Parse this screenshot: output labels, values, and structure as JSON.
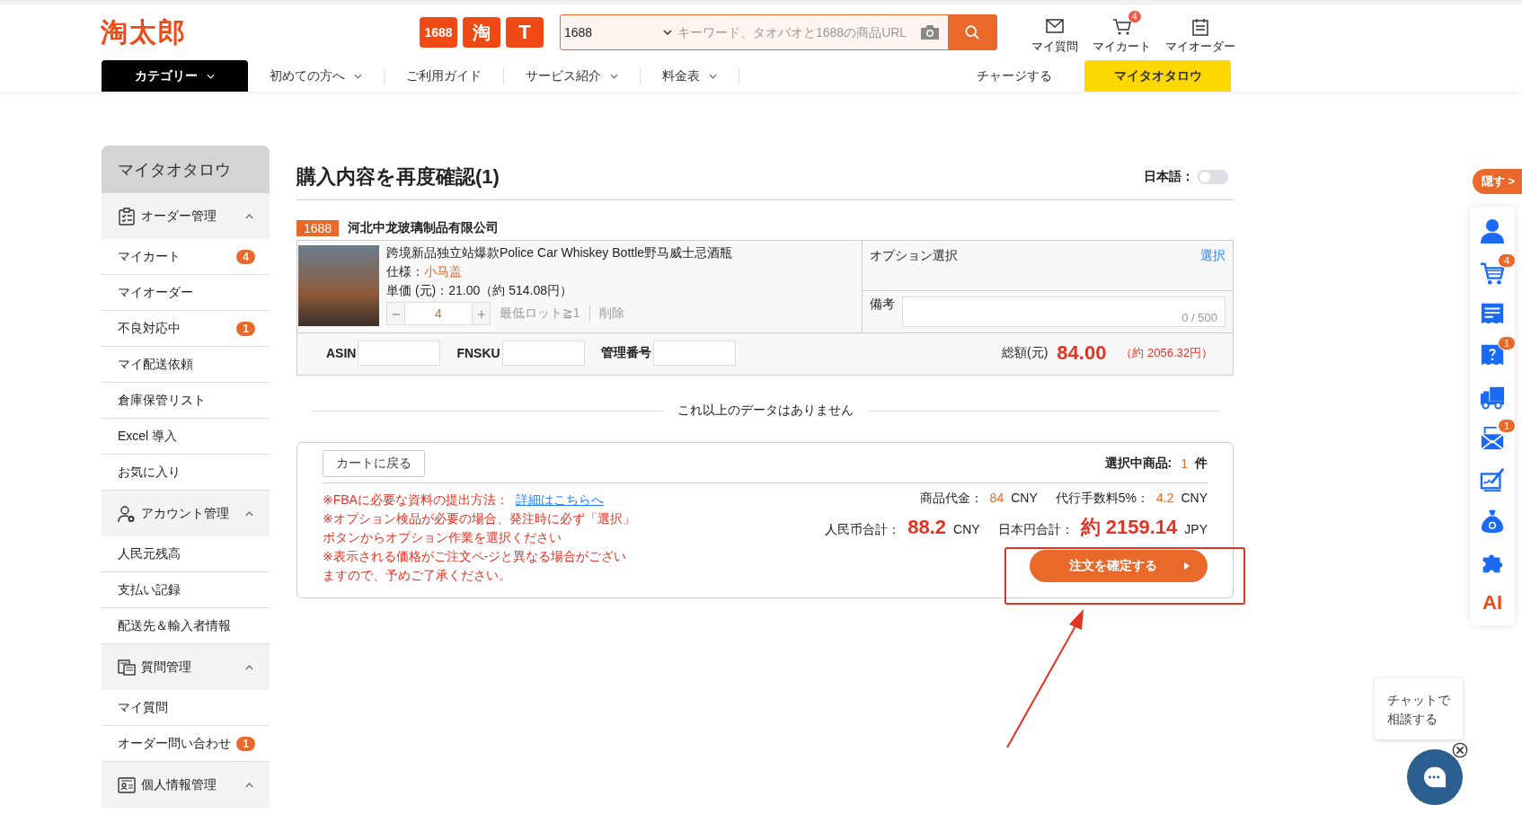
{
  "header": {
    "logo": "淘太郎",
    "platform_badges": [
      "1688",
      "淘",
      "T"
    ],
    "search": {
      "scope": "1688",
      "placeholder": "キーワード、タオバオと1688の商品URL"
    },
    "user_links": [
      {
        "kind": "mail",
        "label": "マイ質問"
      },
      {
        "kind": "cart",
        "label": "マイカート",
        "badge": "4"
      },
      {
        "kind": "orders",
        "label": "マイオーダー"
      }
    ]
  },
  "nav": {
    "items": [
      {
        "kind": "category",
        "label": "カテゴリー",
        "has_menu": true
      },
      {
        "kind": "link",
        "label": "初めての方へ",
        "has_menu": true
      },
      {
        "kind": "link",
        "label": "ご利用ガイド",
        "has_menu": false
      },
      {
        "kind": "link",
        "label": "サービス紹介",
        "has_menu": true
      },
      {
        "kind": "link",
        "label": "料金表",
        "has_menu": true
      },
      {
        "kind": "plain",
        "label": "チャージする",
        "has_menu": false
      },
      {
        "kind": "highlight",
        "label": "マイタオタロウ",
        "has_menu": false
      }
    ]
  },
  "sidebar": {
    "title": "マイタオタロウ",
    "sections": [
      {
        "kind": "order",
        "title": "オーダー管理",
        "expanded": true,
        "items": [
          {
            "label": "マイカート",
            "badge": "4"
          },
          {
            "label": "マイオーダー"
          },
          {
            "label": "不良対応中",
            "badge": "1"
          },
          {
            "label": "マイ配送依頼"
          },
          {
            "label": "倉庫保管リスト"
          },
          {
            "label": "Excel 導入"
          },
          {
            "label": "お気に入り"
          }
        ]
      },
      {
        "kind": "account",
        "title": "アカウント管理",
        "expanded": true,
        "items": [
          {
            "label": "人民元残高"
          },
          {
            "label": "支払い記録"
          },
          {
            "label": "配送先＆輸入者情報"
          }
        ]
      },
      {
        "kind": "question",
        "title": "質問管理",
        "expanded": true,
        "items": [
          {
            "label": "マイ質問"
          },
          {
            "label": "オーダー問い合わせ",
            "badge": "1"
          }
        ]
      },
      {
        "kind": "profile",
        "title": "個人情報管理",
        "expanded": true
      }
    ]
  },
  "main": {
    "title": "購入内容を再度確認(1)",
    "language_toggle": {
      "label": "日本語：",
      "on": false
    },
    "seller": {
      "platform": "1688",
      "name": "河北中龙玻璃制品有限公司"
    },
    "item": {
      "title": "跨境新品独立站爆款Police Car Whiskey Bottle野马威士忌酒瓶",
      "spec_label": "仕様：",
      "spec_value": "小马盖",
      "unit_price": "単価 (元)：21.00（約 514.08円）",
      "quantity": "4",
      "min_lot": "最低ロット≧1",
      "delete": "削除",
      "option_label": "オプション選択",
      "option_link": "選択",
      "remark_label": "備考",
      "remark_counter": "0 / 500"
    },
    "fields": [
      {
        "label": "ASIN"
      },
      {
        "label": "FNSKU"
      },
      {
        "label": "管理番号"
      }
    ],
    "total_label": "総額(元)",
    "total": "84.00",
    "total_jpy": "（約 2056.32円）",
    "end_message": "これ以上のデータはありません"
  },
  "summary": {
    "back_button": "カートに戻る",
    "selected_label": "選択中商品:",
    "selected_count": "1",
    "selected_unit": "件",
    "notes": [
      {
        "text": "※FBAに必要な資料の提出方法：",
        "link": "詳細はこちらへ"
      },
      {
        "text": "※オプション検品が必要の場合、発注時に必ず「選択」"
      },
      {
        "text": "ボタンからオプション作業を選択ください"
      },
      {
        "text": "※表示される価格がご注文ペ-ジと異なる場合がござい"
      },
      {
        "text": "ますので、予めご了承ください。"
      }
    ],
    "goods_label": "商品代金：",
    "goods_value": "84",
    "goods_unit": "CNY",
    "fee_label": "代行手数料5%：",
    "fee_value": "4.2",
    "fee_unit": "CNY",
    "rmb_label": "人民币合計：",
    "rmb_value": "88.2",
    "rmb_unit": "CNY",
    "jpy_label": "日本円合計：",
    "jpy_value": "約 2159.14",
    "jpy_unit": "JPY",
    "confirm_button": "注文を確定する"
  },
  "rail": {
    "hide_button": "隠す >",
    "tools": [
      {
        "kind": "person"
      },
      {
        "kind": "cart",
        "badge": "4"
      },
      {
        "kind": "receipt"
      },
      {
        "kind": "question",
        "badge": "1"
      },
      {
        "kind": "truck"
      },
      {
        "kind": "mail",
        "badge": "1"
      },
      {
        "kind": "sign"
      },
      {
        "kind": "money"
      },
      {
        "kind": "puzzle"
      },
      {
        "kind": "ai",
        "label": "AI"
      }
    ]
  },
  "chat": {
    "lines": [
      "チャットで",
      "相談する"
    ]
  }
}
